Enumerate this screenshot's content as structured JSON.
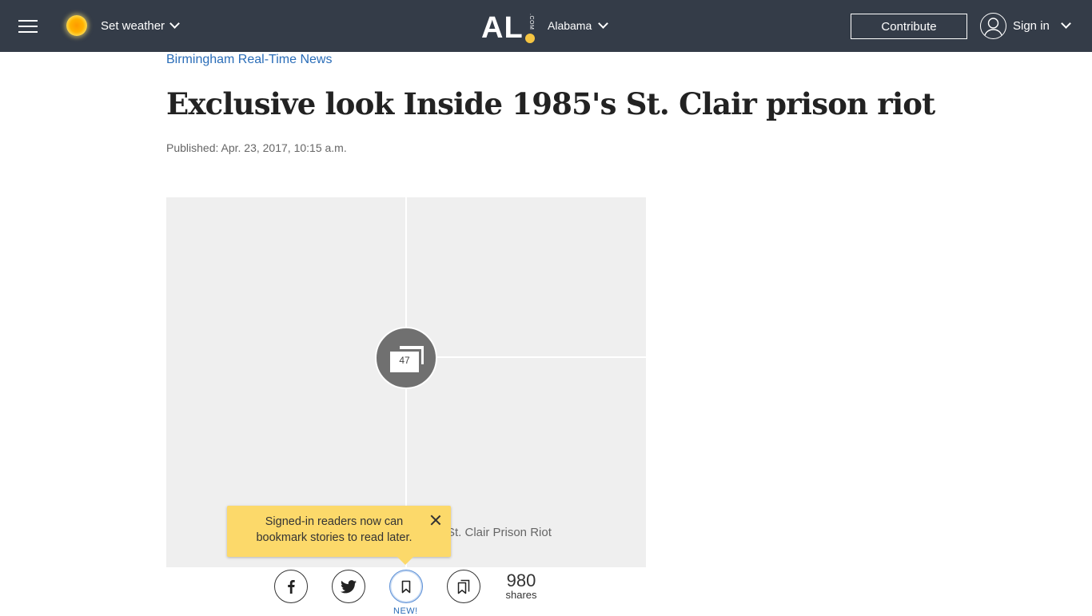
{
  "header": {
    "menu_icon": "hamburger-menu-icon",
    "weather": {
      "icon": "sun-icon",
      "label": "Set weather",
      "chevron": "chevron-down-icon"
    },
    "logo": {
      "text": "AL",
      "suffix": ".COM"
    },
    "region": {
      "label": "Alabama",
      "chevron": "chevron-down-icon"
    },
    "contribute_label": "Contribute",
    "signin": {
      "icon": "user-avatar-icon",
      "label": "Sign in",
      "chevron": "chevron-down-icon"
    },
    "colors": {
      "background": "#343c48",
      "logo_dot": "#f5c542"
    }
  },
  "article": {
    "section": "Birmingham Real-Time News",
    "headline": "Exclusive look Inside 1985's St. Clair prison riot",
    "published": "Published: Apr. 23, 2017, 10:15 a.m.",
    "gallery": {
      "photo_count": "47",
      "caption": "St. Clair Prison Riot",
      "icon": "gallery-stack-icon"
    }
  },
  "tooltip": {
    "text": "Signed-in readers now can bookmark stories to read later.",
    "close_icon": "close-icon",
    "color": "#fcd96a"
  },
  "share_bar": {
    "buttons": [
      {
        "name": "facebook",
        "icon": "facebook-icon"
      },
      {
        "name": "twitter",
        "icon": "twitter-icon"
      },
      {
        "name": "bookmark",
        "icon": "bookmark-icon",
        "badge": "NEW!"
      },
      {
        "name": "saved-stories",
        "icon": "bookmarks-stack-icon"
      }
    ],
    "share_count": "980",
    "share_label": "shares"
  },
  "colors": {
    "link": "#2a6db8",
    "headline": "#222222"
  }
}
